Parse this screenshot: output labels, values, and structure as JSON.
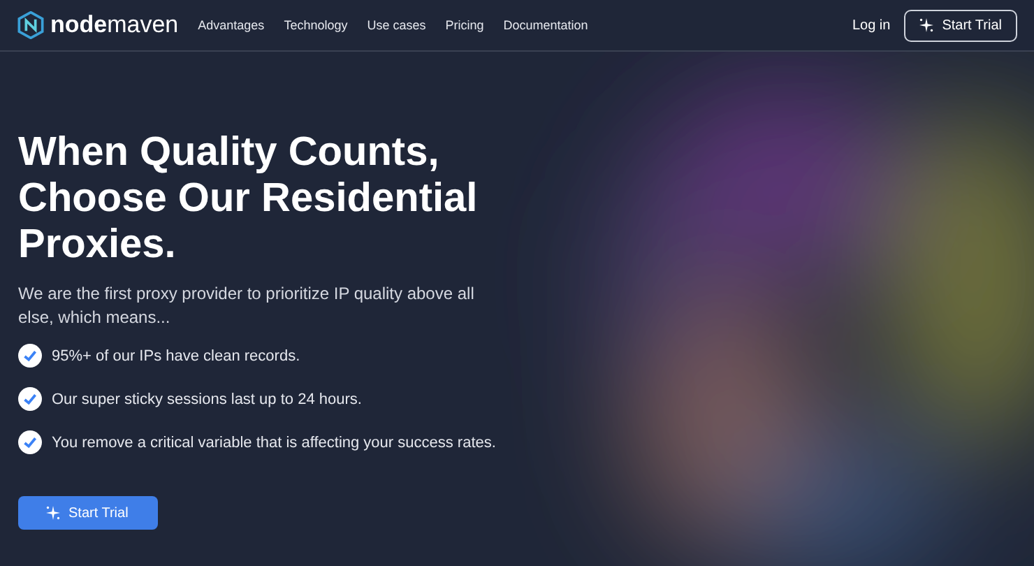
{
  "header": {
    "logo": "**node**maven",
    "nav": [
      {
        "label": "Advantages"
      },
      {
        "label": "Technology"
      },
      {
        "label": "Use cases"
      },
      {
        "label": "Pricing"
      },
      {
        "label": "Documentation"
      }
    ],
    "login": "Log in",
    "cta": "Start Trial"
  },
  "hero": {
    "title": "When Quality Counts, Choose Our Residential Proxies.",
    "intro": "We are the first proxy provider to prioritize IP quality above all else, which means...",
    "points": [
      {
        "text": "95%+ of our IPs have clean records.",
        "checked": true
      },
      {
        "text": "Our super sticky sessions last up to 24 hours.",
        "checked": true
      },
      {
        "text": "You remove a critical variable that is affecting your success rates.",
        "checked": true
      }
    ],
    "cta": "Start Trial"
  }
}
